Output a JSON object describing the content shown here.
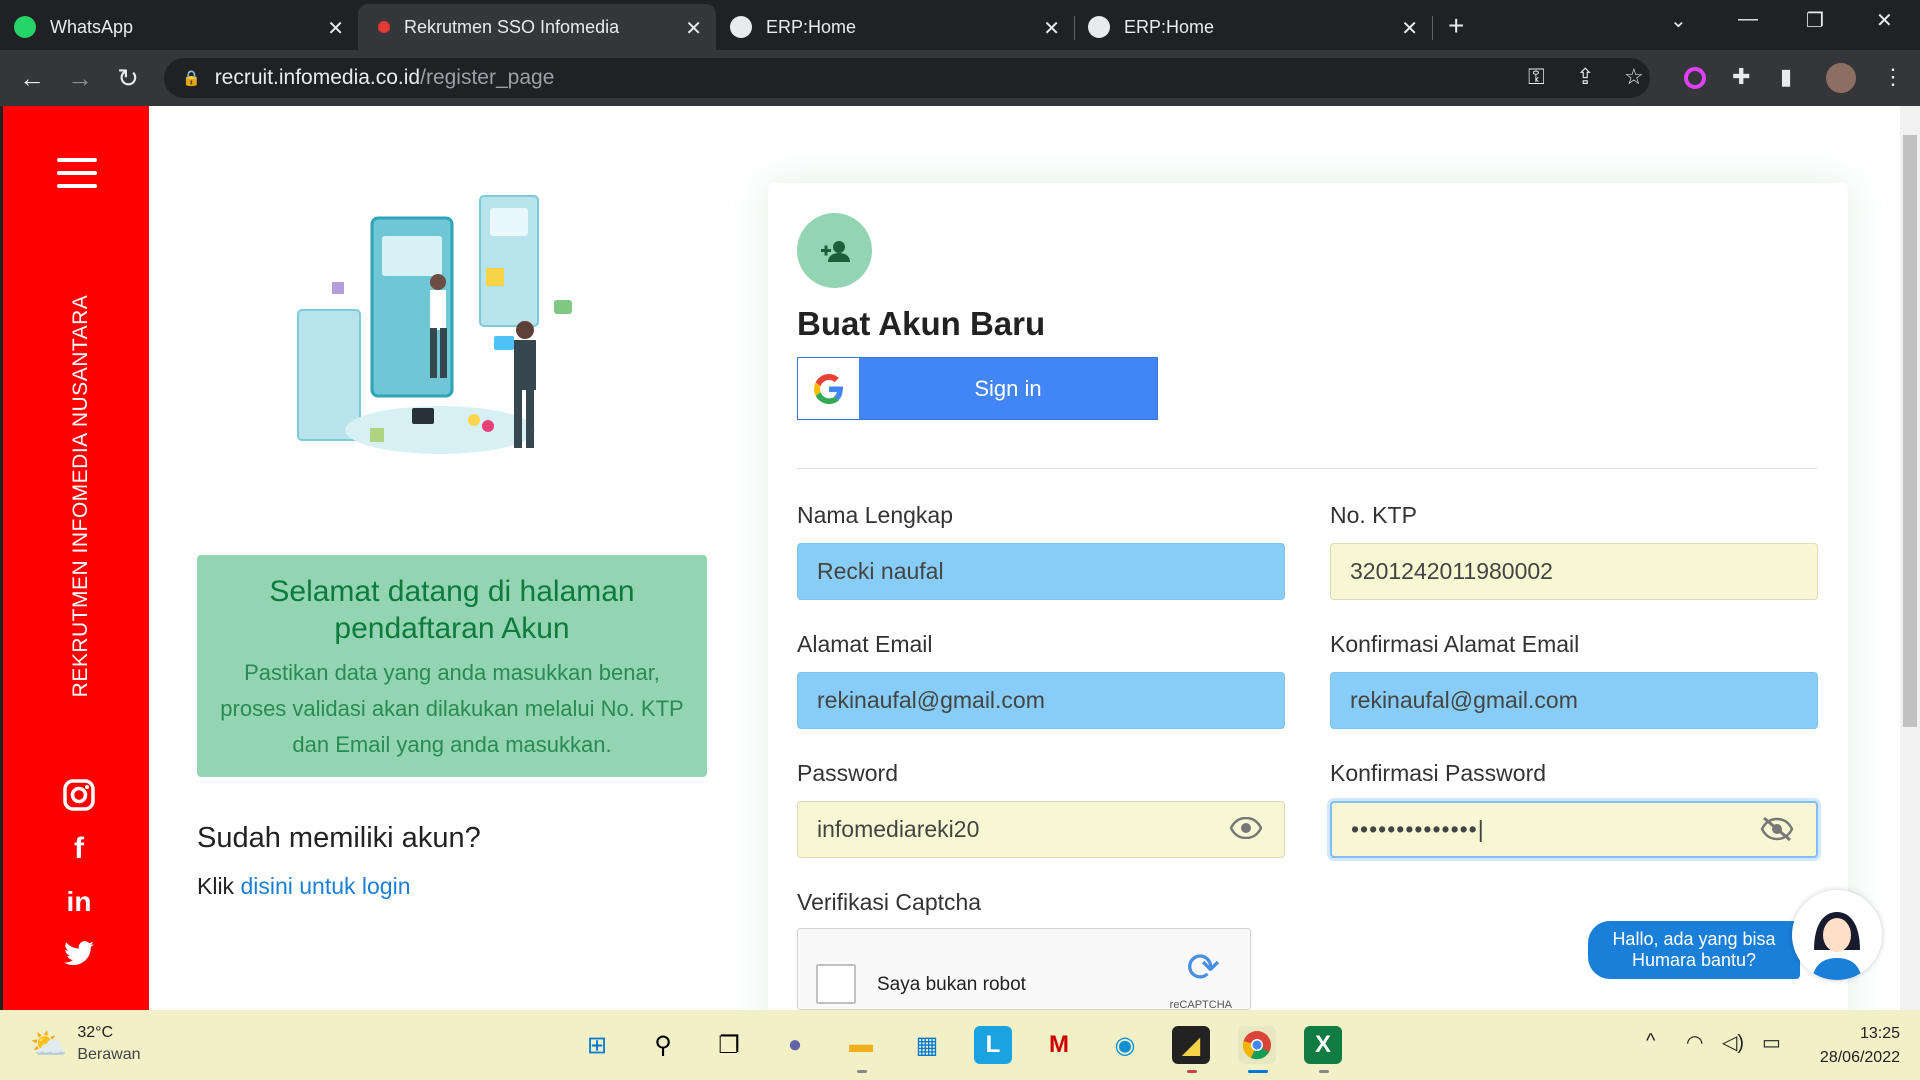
{
  "browser": {
    "tabs": [
      {
        "label": "WhatsApp",
        "icon": "whatsapp-icon",
        "active": false
      },
      {
        "label": "Rekrutmen SSO Infomedia",
        "icon": "infomedia-icon",
        "active": true
      },
      {
        "label": "ERP:Home",
        "icon": "globe-icon",
        "active": false
      },
      {
        "label": "ERP:Home",
        "icon": "globe-icon",
        "active": false
      }
    ],
    "url_host": "recruit.infomedia.co.id",
    "url_path": "/register_page"
  },
  "sidebar": {
    "brand_text": "REKRUTMEN INFOMEDIA NUSANTARA",
    "social_icons": [
      "instagram-icon",
      "facebook-icon",
      "linkedin-icon",
      "twitter-icon"
    ]
  },
  "left": {
    "welcome_title": "Selamat datang di halaman pendaftaran Akun",
    "welcome_body": "Pastikan data yang anda masukkan benar, proses validasi akan dilakukan melalui No. KTP dan Email yang anda masukkan.",
    "already_heading": "Sudah memiliki akun?",
    "login_prefix": "Klik ",
    "login_link": "disini untuk login"
  },
  "form": {
    "title": "Buat Akun Baru",
    "google_label": "Sign in",
    "nama_label": "Nama Lengkap",
    "nama_value": "Recki naufal",
    "ktp_label": "No. KTP",
    "ktp_value": "3201242011980002",
    "email_label": "Alamat Email",
    "email_value": "rekinaufal@gmail.com",
    "email_confirm_label": "Konfirmasi Alamat Email",
    "email_confirm_value": "rekinaufal@gmail.com",
    "password_label": "Password",
    "password_value": "infomediareki20",
    "password_confirm_label": "Konfirmasi Password",
    "password_confirm_value": "••••••••••••••|",
    "captcha_label": "Verifikasi Captcha",
    "captcha_text": "Saya bukan robot",
    "captcha_brand": "reCAPTCHA"
  },
  "chat": {
    "message": "Hallo, ada yang bisa Humara bantu?"
  },
  "taskbar": {
    "temperature": "32°C",
    "weather": "Berawan",
    "time": "13:25",
    "date": "28/06/2022"
  },
  "colors": {
    "sidebar": "#ff0000",
    "accent_green": "#93d5b3",
    "google_blue": "#4285f4",
    "field_blue": "#87cdf8",
    "field_yellow": "#f8f7d4"
  }
}
